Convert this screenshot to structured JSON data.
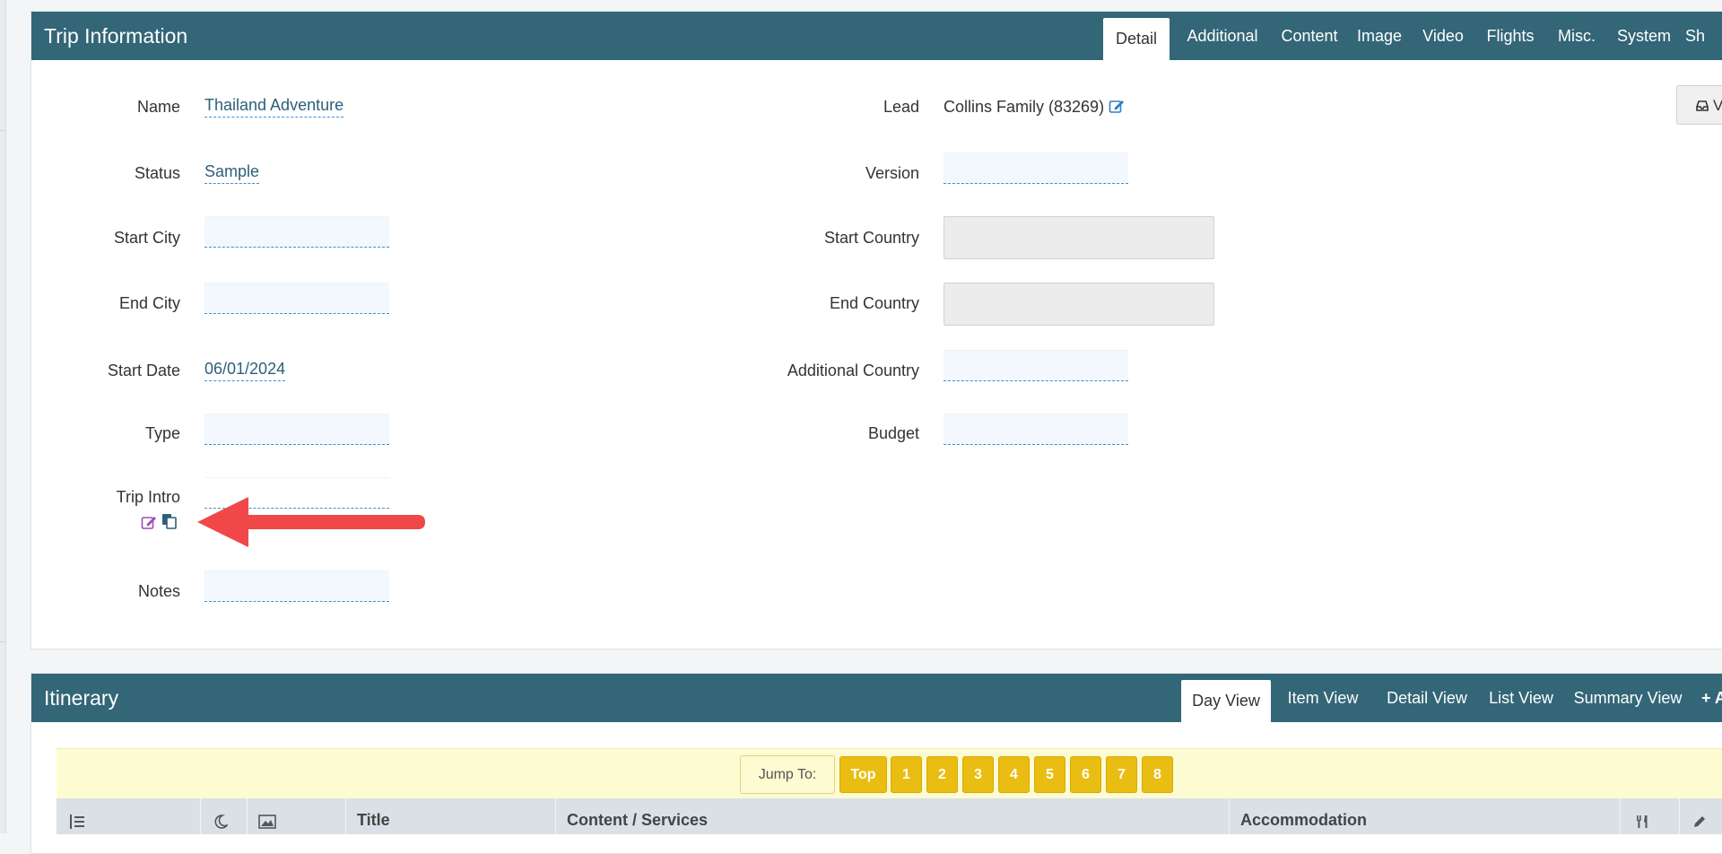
{
  "trip": {
    "title": "Trip Information",
    "tabs": [
      "Detail",
      "Additional",
      "Content",
      "Image",
      "Video",
      "Flights",
      "Misc.",
      "System",
      "Sh"
    ],
    "active_tab": "Detail",
    "fields": {
      "name": {
        "label": "Name",
        "value": "Thailand Adventure"
      },
      "status": {
        "label": "Status",
        "value": "Sample"
      },
      "start_city": {
        "label": "Start City",
        "value": ""
      },
      "end_city": {
        "label": "End City",
        "value": ""
      },
      "start_date": {
        "label": "Start Date",
        "value": "06/01/2024"
      },
      "type": {
        "label": "Type",
        "value": ""
      },
      "trip_intro": {
        "label": "Trip Intro",
        "value": ""
      },
      "notes": {
        "label": "Notes",
        "value": ""
      },
      "lead": {
        "label": "Lead",
        "value": "Collins Family (83269)"
      },
      "version": {
        "label": "Version",
        "value": ""
      },
      "start_country": {
        "label": "Start Country",
        "value": ""
      },
      "end_country": {
        "label": "End Country",
        "value": ""
      },
      "additional_country": {
        "label": "Additional Country",
        "value": ""
      },
      "budget": {
        "label": "Budget",
        "value": ""
      }
    },
    "view_button": "V"
  },
  "itinerary": {
    "title": "Itinerary",
    "tabs": [
      "Day View",
      "Item View",
      "Detail View",
      "List View",
      "Summary View",
      "+ A"
    ],
    "active_tab": "Day View",
    "jump_label": "Jump To:",
    "jump_buttons": [
      "Top",
      "1",
      "2",
      "3",
      "4",
      "5",
      "6",
      "7",
      "8"
    ],
    "columns": [
      "Title",
      "Content / Services",
      "Accommodation"
    ]
  },
  "colors": {
    "header": "#336677",
    "jump_button": "#e9bd12",
    "arrow": "#f04848"
  }
}
